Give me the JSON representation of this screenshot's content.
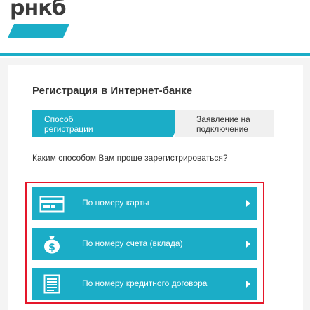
{
  "brand": {
    "logo_text": "рнкб"
  },
  "page": {
    "title": "Регистрация в Интернет-банке"
  },
  "steps": [
    {
      "label_line1": "Способ",
      "label_line2": "регистрации"
    },
    {
      "label_line1": "Заявление на",
      "label_line2": "подключение"
    }
  ],
  "question": "Каким способом Вам проще зарегистрироваться?",
  "options": [
    {
      "label": "По номеру карты",
      "icon": "credit-card-icon"
    },
    {
      "label": "По номеру счета (вклада)",
      "icon": "money-bag-icon"
    },
    {
      "label": "По номеру кредитного договора",
      "icon": "document-icon"
    }
  ],
  "colors": {
    "accent": "#1badc7",
    "highlight": "#e5172a",
    "logo_text": "#3b3b3b"
  }
}
